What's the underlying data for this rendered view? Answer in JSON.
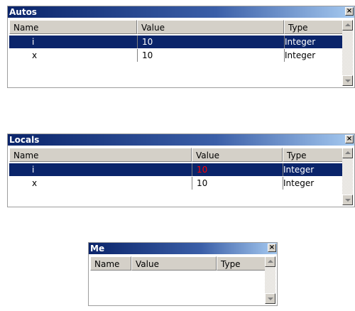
{
  "autos": {
    "title": "Autos",
    "close_glyph": "×",
    "headers": {
      "name": "Name",
      "value": "Value",
      "type": "Type"
    },
    "rows": [
      {
        "name": "i",
        "value": "10",
        "type": "Integer",
        "selected": true
      },
      {
        "name": "x",
        "value": "10",
        "type": "Integer",
        "selected": false
      }
    ]
  },
  "locals": {
    "title": "Locals",
    "close_glyph": "×",
    "headers": {
      "name": "Name",
      "value": "Value",
      "type": "Type"
    },
    "rows": [
      {
        "name": "i",
        "value": "10",
        "type": "Integer",
        "selected": true,
        "value_changed": true
      },
      {
        "name": "x",
        "value": "10",
        "type": "Integer",
        "selected": false
      }
    ]
  },
  "me": {
    "title": "Me",
    "close_glyph": "×",
    "headers": {
      "name": "Name",
      "value": "Value",
      "type": "Type"
    }
  },
  "colors": {
    "title_gradient_start": "#0a246a",
    "title_gradient_end": "#a6caf0",
    "selection": "#0a246a",
    "changed_value": "#ff0000",
    "chrome": "#d4d0c8"
  },
  "icons": [
    "close-icon",
    "scroll-up-icon",
    "scroll-down-icon"
  ]
}
